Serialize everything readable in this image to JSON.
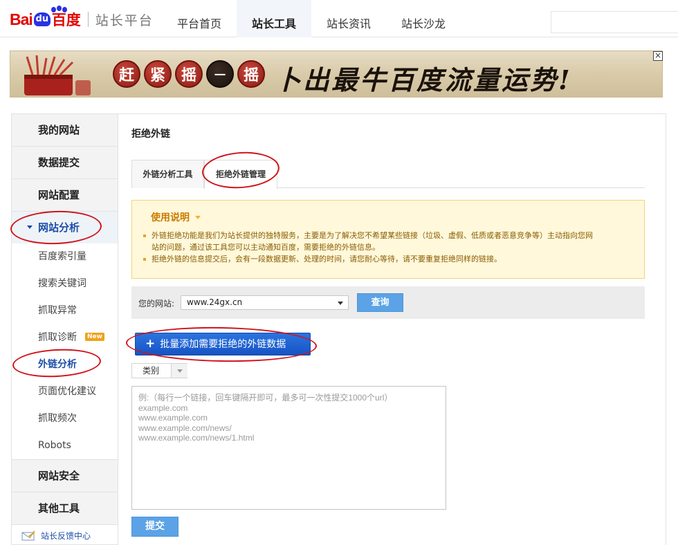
{
  "header": {
    "logo_bai": "Bai",
    "logo_du": "du",
    "logo_baidu": "百度",
    "logo_sub": "站长平台",
    "nav": [
      {
        "label": "平台首页"
      },
      {
        "label": "站长工具"
      },
      {
        "label": "站长资讯"
      },
      {
        "label": "站长沙龙"
      }
    ],
    "active_nav": "站长工具"
  },
  "banner": {
    "circles": [
      "赶",
      "紧",
      "摇",
      "一",
      "摇"
    ],
    "slogan": "卜出最牛百度流量运势!",
    "close_label": "×"
  },
  "sidebar": {
    "groups_top": [
      {
        "label": "我的网站"
      },
      {
        "label": "数据提交"
      },
      {
        "label": "网站配置"
      }
    ],
    "open_group": "网站分析",
    "items": [
      {
        "label": "百度索引量"
      },
      {
        "label": "搜索关键词"
      },
      {
        "label": "抓取异常"
      },
      {
        "label": "抓取诊断",
        "badge": "New"
      },
      {
        "label": "外链分析"
      },
      {
        "label": "页面优化建议"
      },
      {
        "label": "抓取频次"
      },
      {
        "label": "Robots"
      }
    ],
    "groups_bottom": [
      {
        "label": "网站安全"
      },
      {
        "label": "其他工具"
      }
    ],
    "feedback": "站长反馈中心"
  },
  "main": {
    "title": "拒绝外链",
    "tabs": [
      {
        "label": "外链分析工具"
      },
      {
        "label": "拒绝外链管理"
      }
    ],
    "notice": {
      "title": "使用说明",
      "items": [
        "外链拒绝功能是我们为站长提供的独特服务，主要是为了解决您不希望某些链接（垃圾、虚假、低质或者恶意竞争等）主动指向您网站的问题，通过该工具您可以主动通知百度，需要拒绝的外链信息。",
        "拒绝外链的信息提交后，会有一段数据更新、处理的时间，请您耐心等待，请不要重复拒绝同样的链接。"
      ]
    },
    "site_label": "您的网站:",
    "site_value": "www.24gx.cn",
    "query_label": "查询",
    "bulk_label": "批量添加需要拒绝的外链数据",
    "category_label": "类别",
    "placeholder_lines": [
      "例:（每行一个链接，回车键隔开即可，最多可一次性提交1000个url）",
      "example.com",
      "www.example.com",
      "www.example.com/news/",
      "www.example.com/news/1.html"
    ],
    "submit_label": "提交"
  },
  "colors": {
    "baidu_red": "#e10602",
    "baidu_blue": "#2932e1",
    "link_blue": "#1c4ea8",
    "button_blue": "#5ba3e6",
    "annotation_red": "#d0131b"
  }
}
